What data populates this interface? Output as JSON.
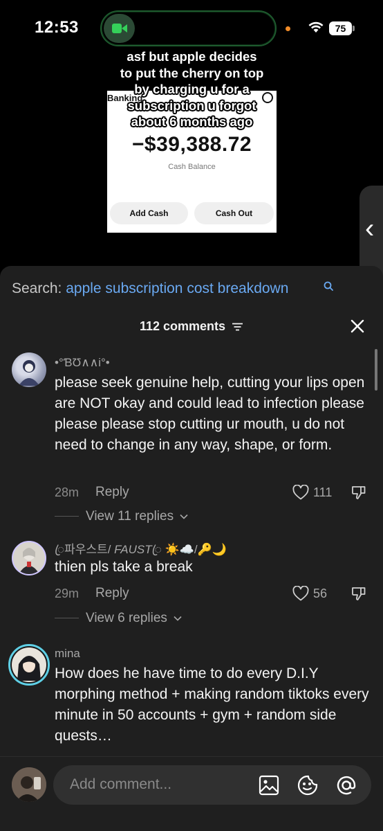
{
  "status_bar": {
    "time": "12:53",
    "battery": "75",
    "icons": [
      "facetime-camera-icon",
      "orange-dot-indicator",
      "wifi-icon",
      "battery-icon"
    ]
  },
  "video": {
    "caption_lines": [
      "asf but apple decides",
      "to put the cherry on top",
      "by charging u for a",
      "subscription u forgot",
      "about 6 months ago"
    ],
    "bank_title": "Banking",
    "amount": "−$39,388.72",
    "balance_label": "Cash Balance",
    "add_cash_label": "Add Cash",
    "cash_out_label": "Cash Out"
  },
  "panel": {
    "search_prefix": "Search:",
    "search_query": "apple subscription cost breakdown",
    "comment_count": "112 comments"
  },
  "comments": [
    {
      "username": "•°ƁƱ∧∧i°•",
      "text": "please seek genuine help, cutting your lips open are NOT okay and could lead to infection please please please stop cutting ur mouth, u do not need to change in any way, shape, or form.",
      "time": "28m",
      "reply_label": "Reply",
      "likes": "111",
      "view_replies": "View 11 replies"
    },
    {
      "username_parts": [
        "ꦿ파우스트/",
        "FAUST",
        "ꦿ ☀️☁️/🔑🌙"
      ],
      "text": "thien pls take a break",
      "time": "29m",
      "reply_label": "Reply",
      "likes": "56",
      "view_replies": "View 6 replies"
    },
    {
      "username": "mina",
      "text": "How does he have time to do every D.I.Y morphing method + making random tiktoks every minute in 50 accounts + gym + random side quests…"
    }
  ],
  "input": {
    "placeholder": "Add comment..."
  },
  "colors": {
    "panel_bg": "#1f1f1f",
    "search_query": "#6aa9f2",
    "island_border": "#1e5a2e",
    "facetime_green": "#35d05a"
  }
}
